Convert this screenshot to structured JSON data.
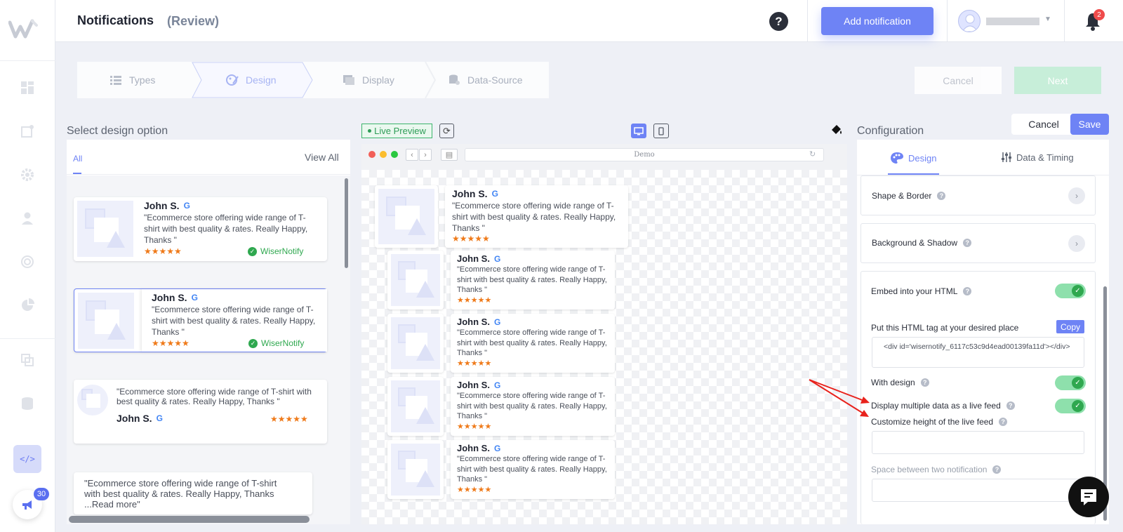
{
  "header": {
    "title": "Notifications",
    "subtitle": "(Review)",
    "help_label": "?",
    "add_button": "Add notification",
    "bell_count": "2"
  },
  "sidebar": {
    "announce_count": "30",
    "active_icon": "</>"
  },
  "stepper": {
    "steps": [
      {
        "label": "Types",
        "icon": "list-icon"
      },
      {
        "label": "Design",
        "icon": "palette-icon",
        "active": true
      },
      {
        "label": "Display",
        "icon": "display-icon"
      },
      {
        "label": "Data-Source",
        "icon": "database-icon"
      }
    ],
    "cancel": "Cancel",
    "next": "Next"
  },
  "left_panel": {
    "title": "Select design option",
    "tab_all": "All",
    "view_all": "View All",
    "cards": [
      {
        "name": "John S.",
        "text": "\"Ecommerce store offering wide range of T-shirt with best quality & rates. Really Happy, Thanks \"",
        "stars": "★★★★★",
        "verified": "WiserNotify"
      },
      {
        "name": "John S.",
        "text": "\"Ecommerce store offering wide range of T-shirt with best quality & rates. Really Happy, Thanks \"",
        "stars": "★★★★★",
        "verified": "WiserNotify"
      },
      {
        "name": "John S.",
        "text": "\"Ecommerce store offering wide range of T-shirt with best quality & rates. Really Happy, Thanks \"",
        "stars": "★★★★★"
      },
      {
        "text": "\"Ecommerce store offering wide range of T-shirt with best quality & rates. Really Happy, Thanks ...Read more\""
      }
    ]
  },
  "preview": {
    "live_label": "Live Preview",
    "url": "Demo",
    "feed": [
      {
        "name": "John S.",
        "text": "\"Ecommerce store offering wide range of T-shirt with best quality & rates. Really Happy, Thanks \"",
        "stars": "★★★★★"
      },
      {
        "name": "John S.",
        "text": "\"Ecommerce store offering wide range of T-shirt with best quality & rates. Really Happy, Thanks \"",
        "stars": "★★★★★"
      },
      {
        "name": "John S.",
        "text": "\"Ecommerce store offering wide range of T-shirt with best quality & rates. Really Happy, Thanks \"",
        "stars": "★★★★★"
      },
      {
        "name": "John S.",
        "text": "\"Ecommerce store offering wide range of T-shirt with best quality & rates. Really Happy, Thanks \"",
        "stars": "★★★★★"
      },
      {
        "name": "John S.",
        "text": "\"Ecommerce store offering wide range of T-shirt with best quality & rates. Really Happy, Thanks \"",
        "stars": "★★★★★"
      }
    ]
  },
  "config": {
    "title": "Configuration",
    "cancel": "Cancel",
    "save": "Save",
    "tab_design": "Design",
    "tab_data": "Data & Timing",
    "shape_border": "Shape & Border",
    "background_shadow": "Background & Shadow",
    "embed": "Embed into your HTML",
    "put_tag": "Put this HTML tag at your desired place",
    "copy": "Copy",
    "code": "<div id='wisernotify_6117c53c9d4ead00139fa11d'></div>",
    "with_design": "With design",
    "multiple_feed": "Display multiple data as a live feed",
    "custom_height": "Customize height of the live feed",
    "space_between": "Space between two notification",
    "toggles": {
      "embed": true,
      "with_design": true,
      "multiple_feed": true
    }
  },
  "colors": {
    "accent": "#6e83f5",
    "success": "#2fa84f",
    "star": "#ef7a1a",
    "annotation_arrow": "#e8221c"
  }
}
